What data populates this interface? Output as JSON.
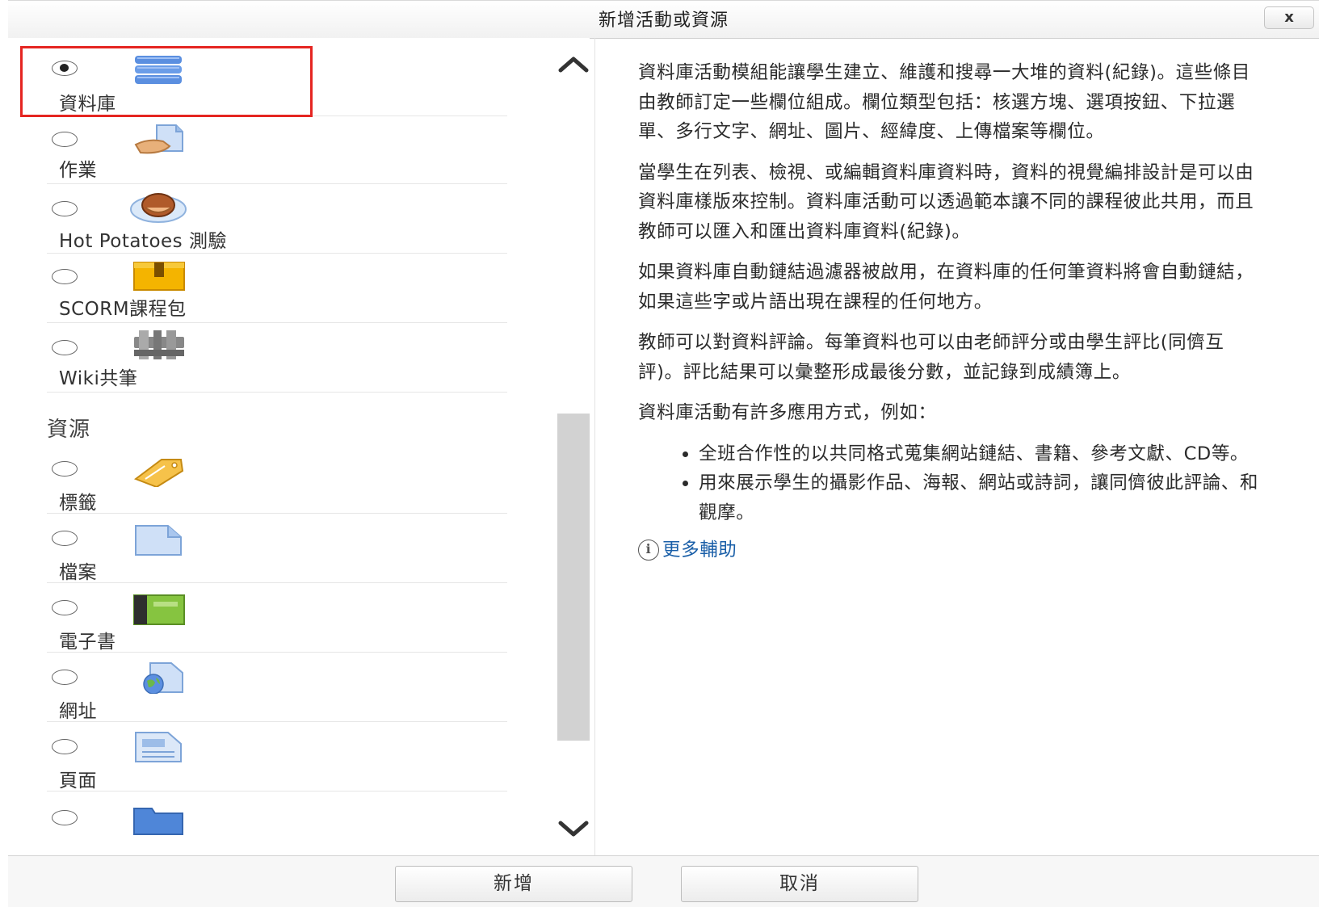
{
  "dialog": {
    "title": "新增活動或資源",
    "close_label": "x"
  },
  "activities": [
    {
      "label": "資料庫",
      "icon": "database-icon",
      "selected": true
    },
    {
      "label": "作業",
      "icon": "assignment-icon",
      "selected": false
    },
    {
      "label": "Hot Potatoes 測驗",
      "icon": "hotpot-icon",
      "selected": false
    },
    {
      "label": "SCORM課程包",
      "icon": "scorm-package-icon",
      "selected": false
    },
    {
      "label": "Wiki共筆",
      "icon": "wiki-icon",
      "selected": false
    }
  ],
  "resources_heading": "資源",
  "resources": [
    {
      "label": "標籤",
      "icon": "label-tag-icon",
      "selected": false
    },
    {
      "label": "檔案",
      "icon": "file-icon",
      "selected": false
    },
    {
      "label": "電子書",
      "icon": "book-icon",
      "selected": false
    },
    {
      "label": "網址",
      "icon": "url-icon",
      "selected": false
    },
    {
      "label": "頁面",
      "icon": "page-icon",
      "selected": false
    },
    {
      "label": "",
      "icon": "folder-icon",
      "selected": false
    }
  ],
  "help": {
    "paragraphs": [
      "資料庫活動模組能讓學生建立、維護和搜尋一大堆的資料(紀錄)。這些條目由教師訂定一些欄位組成。欄位類型包括：核選方塊、選項按鈕、下拉選單、多行文字、網址、圖片、經緯度、上傳檔案等欄位。",
      "當學生在列表、檢視、或編輯資料庫資料時，資料的視覺編排設計是可以由資料庫樣版來控制。資料庫活動可以透過範本讓不同的課程彼此共用，而且教師可以匯入和匯出資料庫資料(紀錄)。",
      "如果資料庫自動鏈結過濾器被啟用，在資料庫的任何筆資料將會自動鏈結，如果這些字或片語出現在課程的任何地方。",
      "教師可以對資料評論。每筆資料也可以由老師評分或由學生評比(同儕互評)。評比結果可以彙整形成最後分數，並記錄到成績簿上。",
      "資料庫活動有許多應用方式，例如："
    ],
    "bullets": [
      "全班合作性的以共同格式蒐集網站鏈結、書籍、參考文獻、CD等。",
      "用來展示學生的攝影作品、海報、網站或詩詞，讓同儕彼此評論、和觀摩。"
    ],
    "more_help": "更多輔助"
  },
  "footer": {
    "add_label": "新增",
    "cancel_label": "取消"
  },
  "colors": {
    "selection_outline": "#e52521",
    "link": "#1a5fa8"
  }
}
